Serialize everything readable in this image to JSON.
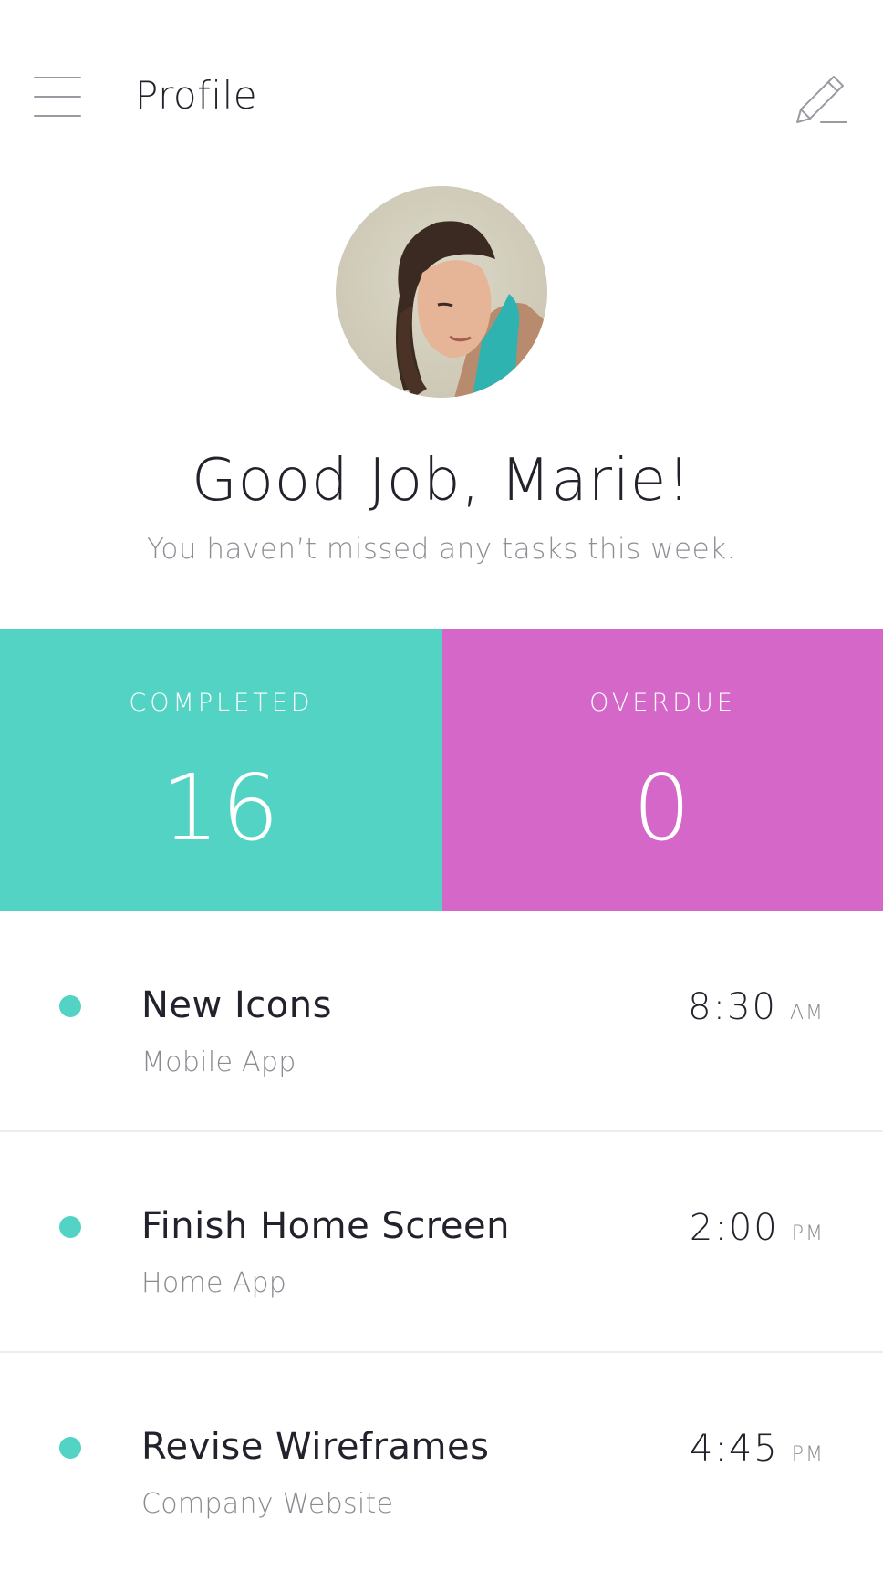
{
  "header": {
    "title": "Profile",
    "menu_icon": "hamburger-menu-icon",
    "edit_icon": "pencil-edit-icon"
  },
  "profile": {
    "greeting": "Good Job, Marie!",
    "subtitle": "You haven’t missed any tasks this week."
  },
  "stats": {
    "completed": {
      "label": "COMPLETED",
      "value": "16",
      "color": "#52d3c3"
    },
    "overdue": {
      "label": "OVERDUE",
      "value": "0",
      "color": "#d567c9"
    }
  },
  "tasks": [
    {
      "title": "New Icons",
      "project": "Mobile App",
      "time": "8:30",
      "period": "AM",
      "dot_color": "#52d3c3"
    },
    {
      "title": "Finish Home Screen",
      "project": "Home App",
      "time": "2:00",
      "period": "PM",
      "dot_color": "#52d3c3"
    },
    {
      "title": "Revise Wireframes",
      "project": "Company Website",
      "time": "4:45",
      "period": "PM",
      "dot_color": "#52d3c3"
    }
  ]
}
